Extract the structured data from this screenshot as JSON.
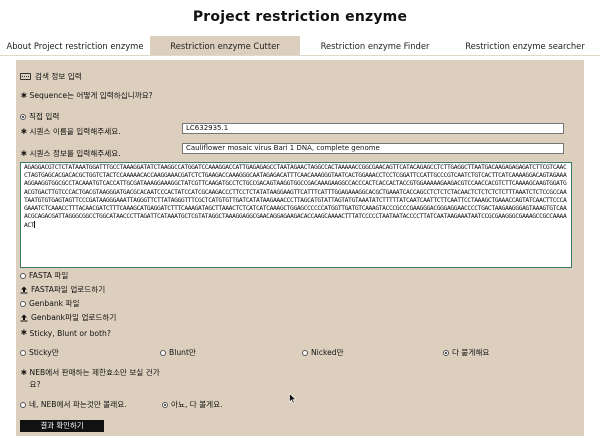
{
  "app": {
    "title": "Project restriction enzyme"
  },
  "tabs": [
    {
      "label": "About Project restriction enzyme",
      "active": false
    },
    {
      "label": "Restriction enzyme Cutter",
      "active": true
    },
    {
      "label": "Restriction enzyme Finder",
      "active": false
    },
    {
      "label": "Restriction enzyme searcher",
      "active": false
    }
  ],
  "form": {
    "section_title": "검색 정보 입력",
    "input_method_question": "Sequence는 어떻게 입력하십니까요?",
    "direct_input_label": "직접 입력",
    "accession_label": "시퀀스 이름을 입력해주세요.",
    "accession_value": "LC632935.1",
    "description_label": "시퀀스 정보를 입력해주세요.",
    "description_value": "Cauliflower mosaic virus Bari 1 DNA, complete genome",
    "sequence": "AGAGGACGTCTCTATAAATGGATTTGCCTAAAGGATATCTAAGGCCATGGATCCAAAGGACCATTGAGAGAGCCTAATAGAACTAGGCCACTAAAAACCGGCGAACAGTTCATACAGAGCCTCTTGAGGCTTAATGACAAGAGAGAGATCTTCGTCAACCTAGTGAGCACGACACGCTGGTCTACTCCAAAAACACCAAGGAAACGATCTCTGAAGACCAAAGGGCAATAGAGACATTTCAACAAAGGGTAATCACTGGAAACCTCCTCGGATTCCATTGCCCGTCAATCTGTCACTTCATCAAAAGGACAGTAGAAAAGGAAGGTGGCGCCTACAAATGTCACCATTGCGATAAAGGAAAGGCTATCGTTCAAGATGCCTCTGCCGACAGTAAGGTGGCCGACAAAGAAGGCCACCCACTCACCACTACCGTGGAAAAAGAAGACGTCCAACCACGTCTTCAAAAGCAAGTGGATGACGTGACTTGTCCCACTGACGTAAGGGATGACGCACAATCCCACTATCCATCGCAAGACCCTTCCTCTATATAAGGAAGTTCATTTCATTTGGAGAAAGGCACGCTGAAATCACCAGCCTCTCTCTACAACTCTCTCTCTCTTTAAATCTCTCCGCCAATAATGTGTGAGTAGTTCCCGATAAGGGAAATTAGGGTTCTTATAGGGTTTCGCTCATGTGTTGATCATATAAGAAACCCTTAGCATGTATTAGTATGTAAATATCTTTTTATCAATCAATTCTTCAATTCCTAAAGCTGAAACCAGTATCAACTTCCCAGAAATCTCAAACCTTTACAACGATCTTTCAAAGCATGAGGATCTTTCAAAGATAGCTTAAACTCTCATCATCAAAGCTGGAGCCCCCCATGGTTGATGTCAAAGTACCCGCCCGAAGGGACGGGAGGAACCCCTGACTAAGAAGGGAGTAAAGTGTCAAACGCAGACGATTAGGGCGGCCTGGCATAACCCTTAGATTCATAAATGCTCGTATAGGCTAAAGGAGGCGAACAGGAGAAGACACCAAGCAAAACTTTATCCCCCTAATAATACCCCTTATCAATAAGAAATAATCCGCGAAGGGCGAAAGCCGCCAAAAACT",
    "fasta_label": "FASTA 파일",
    "fasta_upload_label": "FASTA파일 업로드하기",
    "genbank_label": "Genbank 파일",
    "genbank_upload_label": "Genbank파일 업로드하기",
    "end_type_question": "Sticky, Blunt or both?",
    "end_type_options": [
      {
        "label": "Sticky만",
        "selected": false
      },
      {
        "label": "Blunt만",
        "selected": false
      },
      {
        "label": "Nicked만",
        "selected": false
      },
      {
        "label": "다 붙게해요",
        "selected": true
      }
    ],
    "neb_question": "NEB에서 판매하는 제한효소만 보실 건가요?",
    "neb_options": [
      {
        "label": "네, NEB에서 파는것만 볼래요.",
        "selected": false
      },
      {
        "label": "아뇨, 다 볼게요.",
        "selected": true
      }
    ],
    "submit_label": "결과 확인하기"
  }
}
